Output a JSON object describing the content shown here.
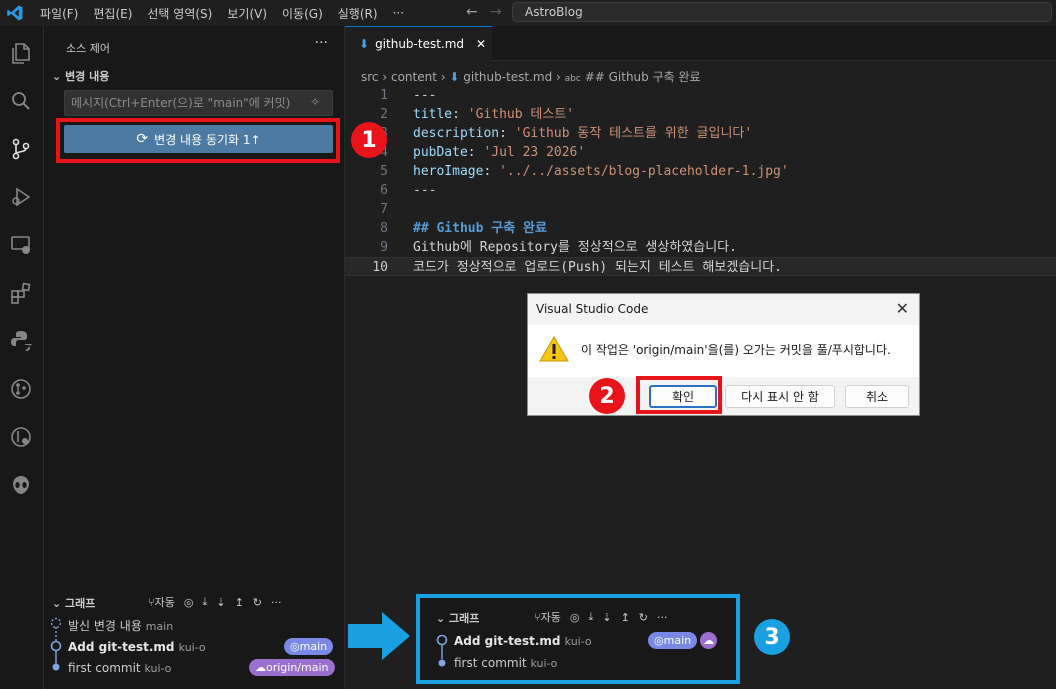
{
  "menu": {
    "items": [
      "파일(F)",
      "편집(E)",
      "선택 영역(S)",
      "보기(V)",
      "이동(G)",
      "실행(R)",
      "···"
    ],
    "search": "AstroBlog"
  },
  "sidebar": {
    "title": "소스 제어",
    "more": "···",
    "changes_header": "변경 내용",
    "message_placeholder": "메시지(Ctrl+Enter(으)로 \"main\"에 커밋)",
    "sync_button": "변경 내용 동기화 1↑",
    "graph": {
      "header": "그래프",
      "auto": "자동",
      "rows": [
        {
          "title": "발신 변경 내용",
          "author": "main",
          "badges": []
        },
        {
          "title": "Add git-test.md",
          "author": "kui-o",
          "badges": [
            {
              "label": "main",
              "color": "#7a88e6"
            }
          ]
        },
        {
          "title": "first commit",
          "author": "kui-o",
          "badges": [
            {
              "label": "origin/main",
              "color": "#9a6fce"
            }
          ]
        }
      ]
    }
  },
  "editor": {
    "tab": "github-test.md",
    "breadcrumb": [
      "src",
      "content",
      "github-test.md",
      "## Github 구축 완료"
    ],
    "lines": [
      {
        "n": "1",
        "parts": [
          {
            "c": "g",
            "t": "---"
          }
        ]
      },
      {
        "n": "2",
        "parts": [
          {
            "c": "k",
            "t": "title"
          },
          {
            "c": "d",
            "t": ": "
          },
          {
            "c": "s",
            "t": "'Github 테스트'"
          }
        ]
      },
      {
        "n": "3",
        "parts": [
          {
            "c": "k",
            "t": "description"
          },
          {
            "c": "d",
            "t": ": "
          },
          {
            "c": "s",
            "t": "'Github 동작 테스트를 위한 글입니다'"
          }
        ]
      },
      {
        "n": "4",
        "parts": [
          {
            "c": "k",
            "t": "pubDate"
          },
          {
            "c": "d",
            "t": ": "
          },
          {
            "c": "s",
            "t": "'Jul 23 2026'"
          }
        ]
      },
      {
        "n": "5",
        "parts": [
          {
            "c": "k",
            "t": "heroImage"
          },
          {
            "c": "d",
            "t": ": "
          },
          {
            "c": "s",
            "t": "'../../assets/blog-placeholder-1.jpg'"
          }
        ]
      },
      {
        "n": "6",
        "parts": [
          {
            "c": "g",
            "t": "---"
          }
        ]
      },
      {
        "n": "7",
        "parts": []
      },
      {
        "n": "8",
        "parts": [
          {
            "c": "h",
            "t": "## Github 구축 완료"
          }
        ]
      },
      {
        "n": "9",
        "parts": [
          {
            "c": "d",
            "t": "Github에 Repository를 정상적으로 생상하였습니다."
          }
        ]
      },
      {
        "n": "10",
        "parts": [
          {
            "c": "d",
            "t": "코드가 정상적으로 업로드(Push) 되는지 테스트 해보겠습니다."
          }
        ]
      }
    ]
  },
  "dialog": {
    "title": "Visual Studio Code",
    "message": "이 작업은 'origin/main'을(를) 오가는 커밋을 풀/푸시합니다.",
    "ok": "확인",
    "dont_show": "다시 표시 안 함",
    "cancel": "취소"
  },
  "callout": {
    "header": "그래프",
    "auto": "자동",
    "rows": [
      {
        "title": "Add git-test.md",
        "author": "kui-o",
        "badge": "main"
      },
      {
        "title": "first commit",
        "author": "kui-o"
      }
    ]
  },
  "markers": [
    "1",
    "2",
    "3"
  ],
  "colors": {
    "red": "#e8141a",
    "blue": "#1a9fe0",
    "sync": "#4d7aa3"
  }
}
